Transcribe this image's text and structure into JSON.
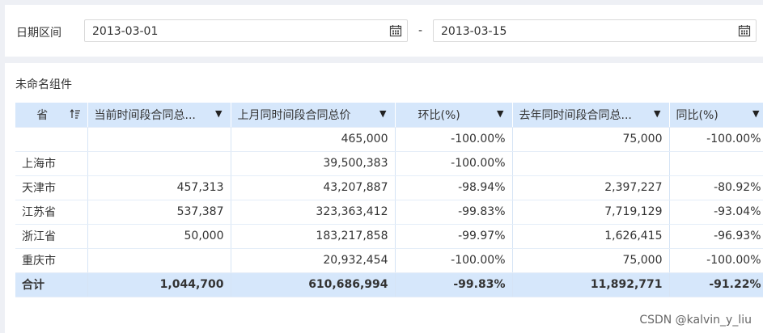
{
  "filter": {
    "label": "日期区间",
    "start_date": "2013-03-01",
    "separator": "-",
    "end_date": "2013-03-15"
  },
  "widget": {
    "title": "未命名组件"
  },
  "table": {
    "columns": [
      "省",
      "当前时间段合同总...",
      "上月同时间段合同总价",
      "环比(%)",
      "去年同时间段合同总...",
      "同比(%)"
    ],
    "rows": [
      [
        "",
        "",
        "465,000",
        "-100.00%",
        "75,000",
        "-100.00%"
      ],
      [
        "上海市",
        "",
        "39,500,383",
        "-100.00%",
        "",
        ""
      ],
      [
        "天津市",
        "457,313",
        "43,207,887",
        "-98.94%",
        "2,397,227",
        "-80.92%"
      ],
      [
        "江苏省",
        "537,387",
        "323,363,412",
        "-99.83%",
        "7,719,129",
        "-93.04%"
      ],
      [
        "浙江省",
        "50,000",
        "183,217,858",
        "-99.97%",
        "1,626,415",
        "-96.93%"
      ],
      [
        "重庆市",
        "",
        "20,932,454",
        "-100.00%",
        "75,000",
        "-100.00%"
      ]
    ],
    "total": [
      "合计",
      "1,044,700",
      "610,686,994",
      "-99.83%",
      "11,892,771",
      "-91.22%"
    ]
  },
  "watermark": "CSDN @kalvin_y_liu",
  "colors": {
    "header_bg": "#d6e7fb",
    "total_bg": "#d6e7fb",
    "grid_line": "#d6e4f5"
  }
}
